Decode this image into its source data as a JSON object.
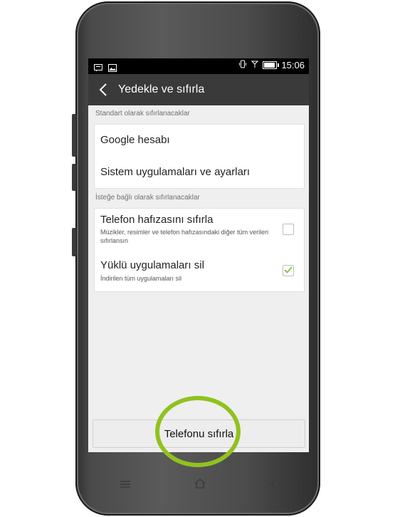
{
  "status_bar": {
    "time": "15:06"
  },
  "app_bar": {
    "title": "Yedekle ve sıfırla"
  },
  "sections": {
    "standard": "Standart olarak sıfırlanacaklar",
    "optional": "İsteğe bağlı olarak sıfırlanacaklar"
  },
  "standard_items": [
    {
      "label": "Google hesabı"
    },
    {
      "label": "Sistem uygulamaları ve ayarları"
    }
  ],
  "optional_items": [
    {
      "label": "Telefon hafızasını sıfırla",
      "desc": "Müzikler, resimler ve telefon hafızasındaki diğer tüm verileri sıfırlansın",
      "checked": false
    },
    {
      "label": "Yüklü uygulamaları sil",
      "desc": "İndirilen tüm uygulamaları sil",
      "checked": true
    }
  ],
  "reset_button": {
    "label": "Telefonu sıfırla"
  },
  "colors": {
    "highlight": "#90c21f",
    "check": "#8bc34a",
    "appbar": "#3a3a3a"
  },
  "icons": [
    "message-icon",
    "image-icon",
    "vibrate-icon",
    "signal-icon",
    "battery-icon",
    "back-arrow-icon",
    "menu-icon",
    "home-icon",
    "nav-back-icon"
  ]
}
